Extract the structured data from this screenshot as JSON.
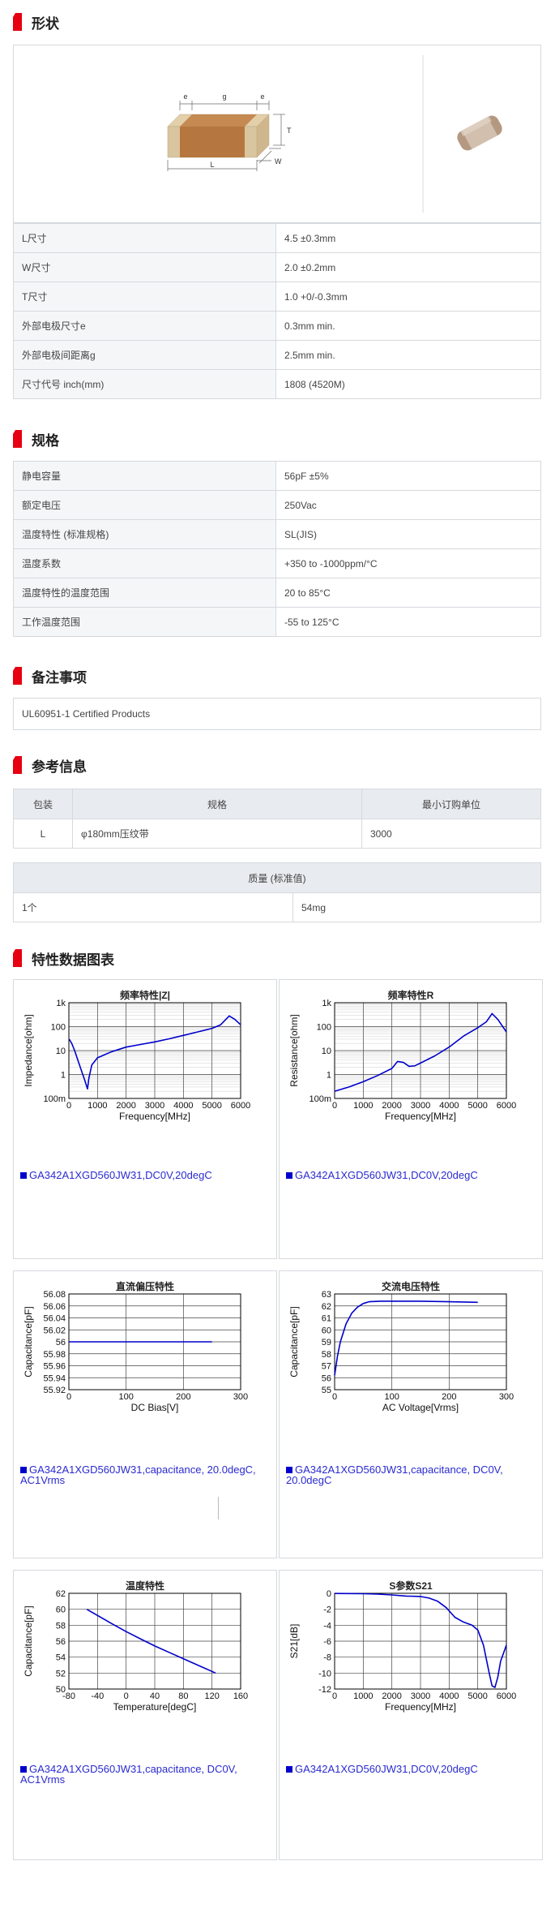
{
  "sections": {
    "shape": "形状",
    "spec": "规格",
    "notes": "备注事项",
    "ref": "参考信息",
    "charts": "特性数据图表"
  },
  "diagram_labels": {
    "e1": "e",
    "g": "g",
    "e2": "e",
    "T": "T",
    "L": "L",
    "W": "W"
  },
  "dimensions": [
    {
      "k": "L尺寸",
      "v": "4.5 ±0.3mm"
    },
    {
      "k": "W尺寸",
      "v": "2.0 ±0.2mm"
    },
    {
      "k": "T尺寸",
      "v": "1.0 +0/-0.3mm"
    },
    {
      "k": "外部电极尺寸e",
      "v": "0.3mm min."
    },
    {
      "k": "外部电极间距离g",
      "v": "2.5mm min."
    },
    {
      "k": "尺寸代号 inch(mm)",
      "v": "1808 (4520M)"
    }
  ],
  "specs": [
    {
      "k": "静电容量",
      "v": "56pF ±5%"
    },
    {
      "k": "额定电压",
      "v": "250Vac"
    },
    {
      "k": "温度特性 (标准规格)",
      "v": "SL(JIS)"
    },
    {
      "k": "温度系数",
      "v": "+350 to -1000ppm/°C"
    },
    {
      "k": "温度特性的温度范围",
      "v": "20 to 85°C"
    },
    {
      "k": "工作温度范围",
      "v": "-55 to 125°C"
    }
  ],
  "notes_text": "UL60951-1 Certified Products",
  "packaging": {
    "headers": [
      "包装",
      "规格",
      "最小订购单位"
    ],
    "row": [
      "L",
      "φ180mm压纹带",
      "3000"
    ]
  },
  "mass": {
    "header": "质量 (标准值)",
    "row": [
      "1个",
      "54mg"
    ]
  },
  "chart_data": [
    {
      "type": "line",
      "title": "频率特性|Z|",
      "xlabel": "Frequency[MHz]",
      "ylabel": "Impedance[ohm]",
      "xlim": [
        0,
        6000
      ],
      "ylim": [
        0.1,
        1000
      ],
      "yscale": "log",
      "xticks": [
        "0",
        "1000",
        "2000",
        "3000",
        "4000",
        "5000",
        "6000"
      ],
      "yticks": [
        "100m",
        "1",
        "10",
        "100",
        "1k"
      ],
      "x": [
        10,
        100,
        200,
        400,
        550,
        650,
        700,
        800,
        1000,
        1500,
        2000,
        2500,
        3000,
        3500,
        4000,
        4500,
        5000,
        5300,
        5600,
        5800,
        6000
      ],
      "y": [
        30,
        20,
        10,
        2,
        0.6,
        0.25,
        0.7,
        2.5,
        5,
        9,
        14,
        18,
        23,
        31,
        43,
        60,
        85,
        120,
        280,
        200,
        120
      ],
      "legend": "GA342A1XGD560JW31,DC0V,20degC"
    },
    {
      "type": "line",
      "title": "频率特性R",
      "xlabel": "Frequency[MHz]",
      "ylabel": "Resistance[ohm]",
      "xlim": [
        0,
        6000
      ],
      "ylim": [
        0.1,
        1000
      ],
      "yscale": "log",
      "xticks": [
        "0",
        "1000",
        "2000",
        "3000",
        "4000",
        "5000",
        "6000"
      ],
      "yticks": [
        "100m",
        "1",
        "10",
        "100",
        "1k"
      ],
      "x": [
        0,
        500,
        1000,
        1500,
        2000,
        2200,
        2400,
        2600,
        2800,
        3000,
        3500,
        4000,
        4500,
        5000,
        5300,
        5500,
        5700,
        6000
      ],
      "y": [
        0.2,
        0.3,
        0.5,
        0.9,
        1.8,
        3.5,
        3.2,
        2.2,
        2.3,
        3,
        6,
        14,
        40,
        90,
        160,
        350,
        200,
        60
      ],
      "legend": "GA342A1XGD560JW31,DC0V,20degC"
    },
    {
      "type": "line",
      "title": "直流偏压特性",
      "xlabel": "DC Bias[V]",
      "ylabel": "Capacitance[pF]",
      "xlim": [
        0,
        300
      ],
      "ylim": [
        55.92,
        56.08
      ],
      "xticks": [
        "0",
        "100",
        "200",
        "300"
      ],
      "yticks": [
        "55.92",
        "55.94",
        "55.96",
        "55.98",
        "56",
        "56.02",
        "56.04",
        "56.06",
        "56.08"
      ],
      "x": [
        0,
        250
      ],
      "y": [
        56,
        56
      ],
      "legend": "GA342A1XGD560JW31,capacitance, 20.0degC, AC1Vrms"
    },
    {
      "type": "line",
      "title": "交流电压特性",
      "xlabel": "AC Voltage[Vrms]",
      "ylabel": "Capacitance[pF]",
      "xlim": [
        0,
        300
      ],
      "ylim": [
        55,
        63
      ],
      "xticks": [
        "0",
        "100",
        "200",
        "300"
      ],
      "yticks": [
        "55",
        "56",
        "57",
        "58",
        "59",
        "60",
        "61",
        "62",
        "63"
      ],
      "x": [
        0,
        5,
        10,
        20,
        30,
        40,
        50,
        60,
        80,
        100,
        150,
        200,
        250
      ],
      "y": [
        56.2,
        57.8,
        59.0,
        60.5,
        61.4,
        61.9,
        62.2,
        62.35,
        62.4,
        62.4,
        62.4,
        62.35,
        62.3
      ],
      "legend": "GA342A1XGD560JW31,capacitance, DC0V, 20.0degC"
    },
    {
      "type": "line",
      "title": "温度特性",
      "xlabel": "Temperature[degC]",
      "ylabel": "Capacitance[pF]",
      "xlim": [
        -80,
        160
      ],
      "ylim": [
        50,
        62
      ],
      "xticks": [
        "-80",
        "-40",
        "0",
        "40",
        "80",
        "120",
        "160"
      ],
      "yticks": [
        "50",
        "52",
        "54",
        "56",
        "58",
        "60",
        "62"
      ],
      "x": [
        -55,
        -20,
        0,
        20,
        40,
        60,
        80,
        100,
        125
      ],
      "y": [
        60.0,
        58.2,
        57.2,
        56.3,
        55.4,
        54.6,
        53.8,
        53.0,
        52.0
      ],
      "legend": "GA342A1XGD560JW31,capacitance, DC0V, AC1Vrms"
    },
    {
      "type": "line",
      "title": "S参数S21",
      "xlabel": "Frequency[MHz]",
      "ylabel": "S21[dB]",
      "xlim": [
        0,
        6000
      ],
      "ylim": [
        -12,
        0
      ],
      "xticks": [
        "0",
        "1000",
        "2000",
        "3000",
        "4000",
        "5000",
        "6000"
      ],
      "yticks": [
        "-12",
        "-10",
        "-8",
        "-6",
        "-4",
        "-2",
        "0"
      ],
      "x": [
        0,
        500,
        1000,
        1500,
        2000,
        2500,
        3000,
        3300,
        3600,
        3900,
        4200,
        4500,
        4800,
        5000,
        5200,
        5400,
        5500,
        5600,
        5700,
        5800,
        6000
      ],
      "y": [
        -0.02,
        -0.03,
        -0.05,
        -0.1,
        -0.2,
        -0.35,
        -0.4,
        -0.6,
        -1.0,
        -1.8,
        -3.0,
        -3.6,
        -4.0,
        -4.6,
        -6.5,
        -10.0,
        -11.6,
        -11.8,
        -10.5,
        -8.5,
        -6.5
      ],
      "legend": "GA342A1XGD560JW31,DC0V,20degC"
    }
  ],
  "colors": {
    "accent": "#e60012",
    "line": "#0000cc",
    "legend": "#2a2ad0"
  }
}
